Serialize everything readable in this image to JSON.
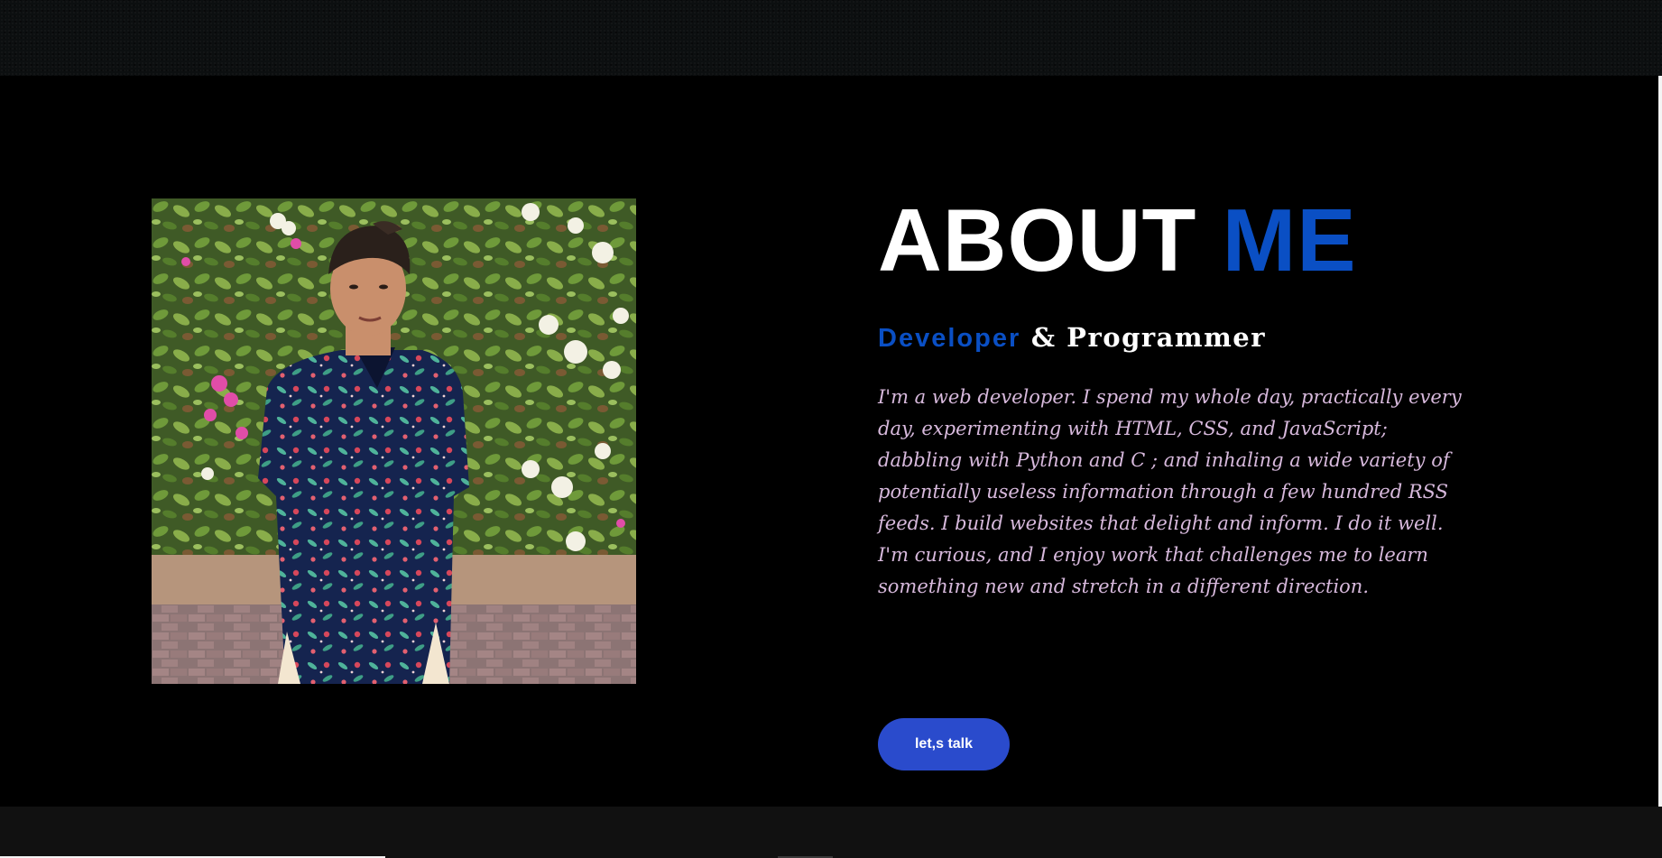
{
  "about": {
    "heading_main": "ABOUT",
    "heading_accent": "ME",
    "role_primary": "Developer",
    "role_connector": "&",
    "role_secondary": "Programmer",
    "bio": "I'm a web developer. I spend my whole day, practically every day, experimenting with HTML, CSS, and JavaScript; dabbling with Python and C ; and inhaling a wide variety of potentially useless information through a few hundred RSS feeds. I build websites that delight and inform. I do it well. I'm curious, and I enjoy work that challenges me to learn something new and stretch in a different direction.",
    "cta_label": "let,s talk",
    "photo_alt": "portrait"
  },
  "colors": {
    "accent": "#0a4fc4",
    "button": "#2a4bcc",
    "bio_text": "#d7b9dc",
    "background": "#000000"
  }
}
